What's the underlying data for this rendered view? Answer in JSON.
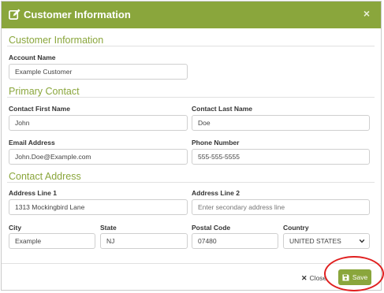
{
  "header": {
    "title": "Customer Information",
    "close_glyph": "×"
  },
  "sections": {
    "customer": "Customer Information",
    "primary": "Primary Contact",
    "address": "Contact Address"
  },
  "fields": {
    "account_name": {
      "label": "Account Name",
      "value": "Example Customer"
    },
    "first_name": {
      "label": "Contact First Name",
      "value": "John"
    },
    "last_name": {
      "label": "Contact Last Name",
      "value": "Doe"
    },
    "email": {
      "label": "Email Address",
      "value": "John.Doe@Example.com"
    },
    "phone": {
      "label": "Phone Number",
      "value": "555-555-5555"
    },
    "address1": {
      "label": "Address Line 1",
      "value": "1313 Mockingbird Lane"
    },
    "address2": {
      "label": "Address Line 2",
      "value": "",
      "placeholder": "Enter secondary address line"
    },
    "city": {
      "label": "City",
      "value": "Example"
    },
    "state": {
      "label": "State",
      "value": "NJ"
    },
    "postal": {
      "label": "Postal Code",
      "value": "07480"
    },
    "country": {
      "label": "Country",
      "value": "UNITED STATES"
    }
  },
  "footer": {
    "close_label": "Close",
    "save_label": "Save"
  },
  "colors": {
    "accent": "#8aa63c",
    "annotation": "#e02020"
  },
  "icons": {
    "header": "edit-icon",
    "close": "close-icon",
    "save": "floppy-disk-icon",
    "country_select": "chevron-down-icon"
  }
}
